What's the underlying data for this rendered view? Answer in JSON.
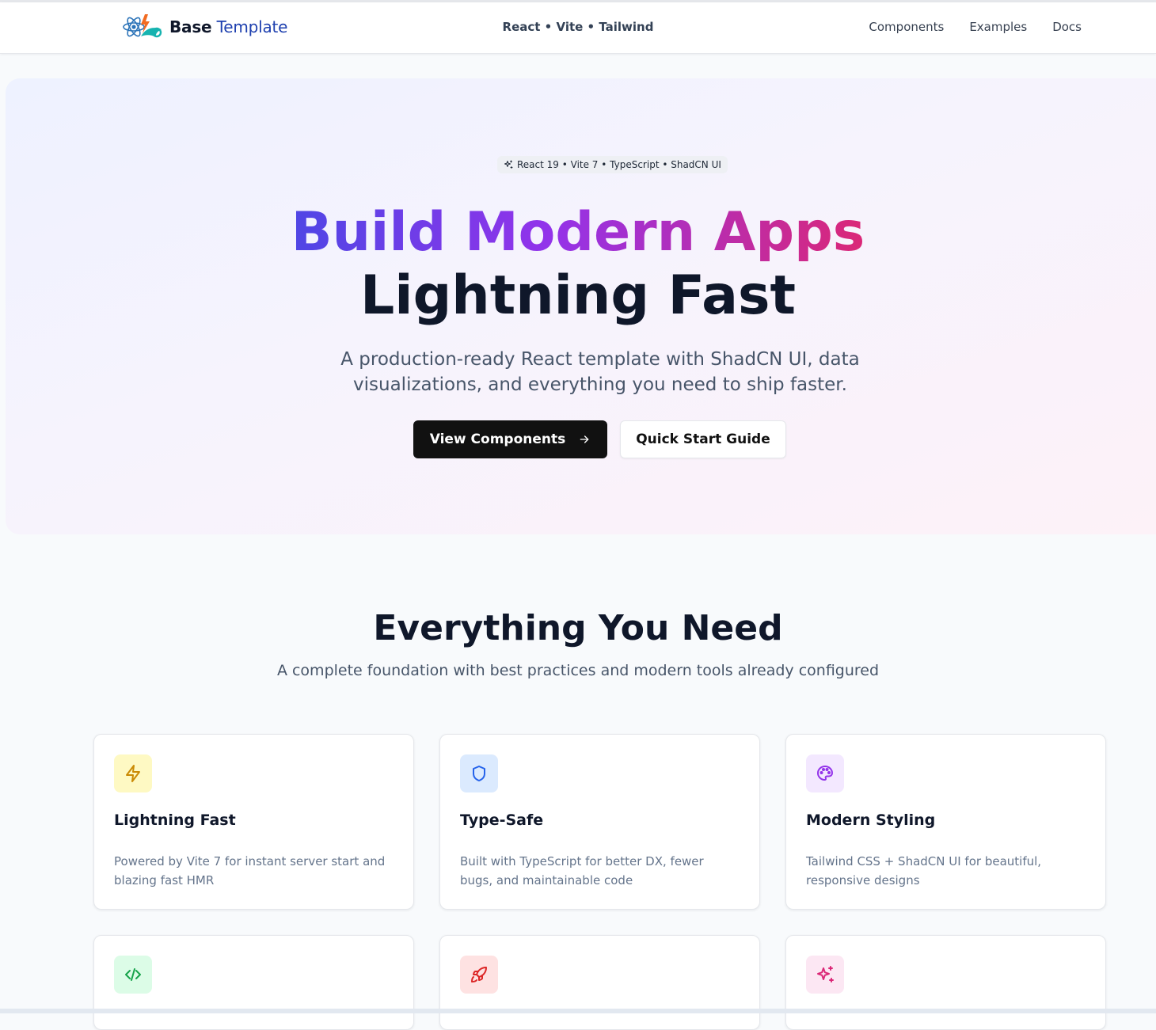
{
  "header": {
    "brand": {
      "strong": "Base",
      "light": "Template"
    },
    "tagline": "React • Vite • Tailwind",
    "nav": [
      "Components",
      "Examples",
      "Docs"
    ]
  },
  "hero": {
    "badge": "React 19 • Vite 7 • TypeScript • ShadCN UI",
    "title_gradient": "Build Modern Apps",
    "title_dark": "Lightning Fast",
    "subtitle": "A production-ready React template with ShadCN UI, data visualizations, and everything you need to ship faster.",
    "primary_button": "View Components",
    "secondary_button": "Quick Start Guide"
  },
  "features_section": {
    "title": "Everything You Need",
    "subtitle": "A complete foundation with best practices and modern tools already configured",
    "cards": [
      {
        "icon": "lightning-icon",
        "title": "Lightning Fast",
        "description": "Powered by Vite 7 for instant server start and blazing fast HMR"
      },
      {
        "icon": "shield-icon",
        "title": "Type-Safe",
        "description": "Built with TypeScript for better DX, fewer bugs, and maintainable code"
      },
      {
        "icon": "palette-icon",
        "title": "Modern Styling",
        "description": "Tailwind CSS + ShadCN UI for beautiful, responsive designs"
      },
      {
        "icon": "code-icon"
      },
      {
        "icon": "rocket-icon"
      },
      {
        "icon": "sparkles-icon"
      }
    ]
  },
  "colors": {
    "primary_button": "#111111",
    "gradient_start": "#4f46e5",
    "gradient_mid": "#9333ea",
    "gradient_end": "#db2777",
    "brand_text": "#1e40af"
  }
}
